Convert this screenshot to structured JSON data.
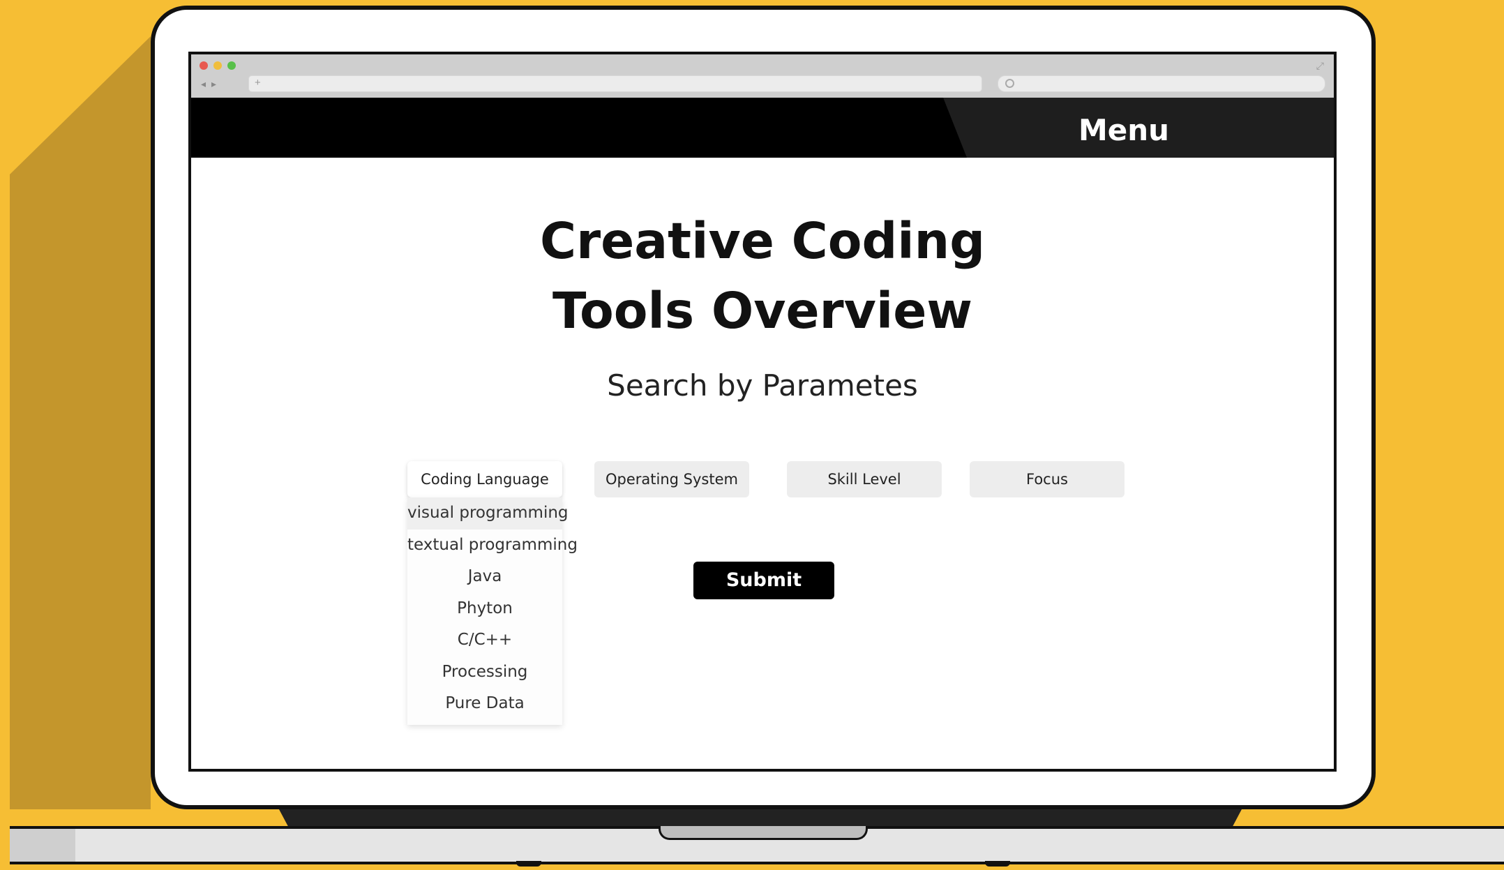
{
  "header": {
    "menu_label": "Menu"
  },
  "main": {
    "title_line1": "Creative Coding",
    "title_line2": "Tools Overview",
    "subtitle": "Search by Parametes"
  },
  "filters": [
    {
      "label": "Coding Language",
      "active": true
    },
    {
      "label": "Operating System",
      "active": false
    },
    {
      "label": "Skill Level",
      "active": false
    },
    {
      "label": "Focus",
      "active": false
    }
  ],
  "dropdown": {
    "items": [
      "visual programming",
      "textual programming",
      "Java",
      "Phyton",
      "C/C++",
      "Processing",
      "Pure Data"
    ],
    "highlighted_index": 0
  },
  "submit_label": "Submit",
  "colors": {
    "background": "#F6BE34",
    "header": "#000000",
    "button": "#000000"
  }
}
